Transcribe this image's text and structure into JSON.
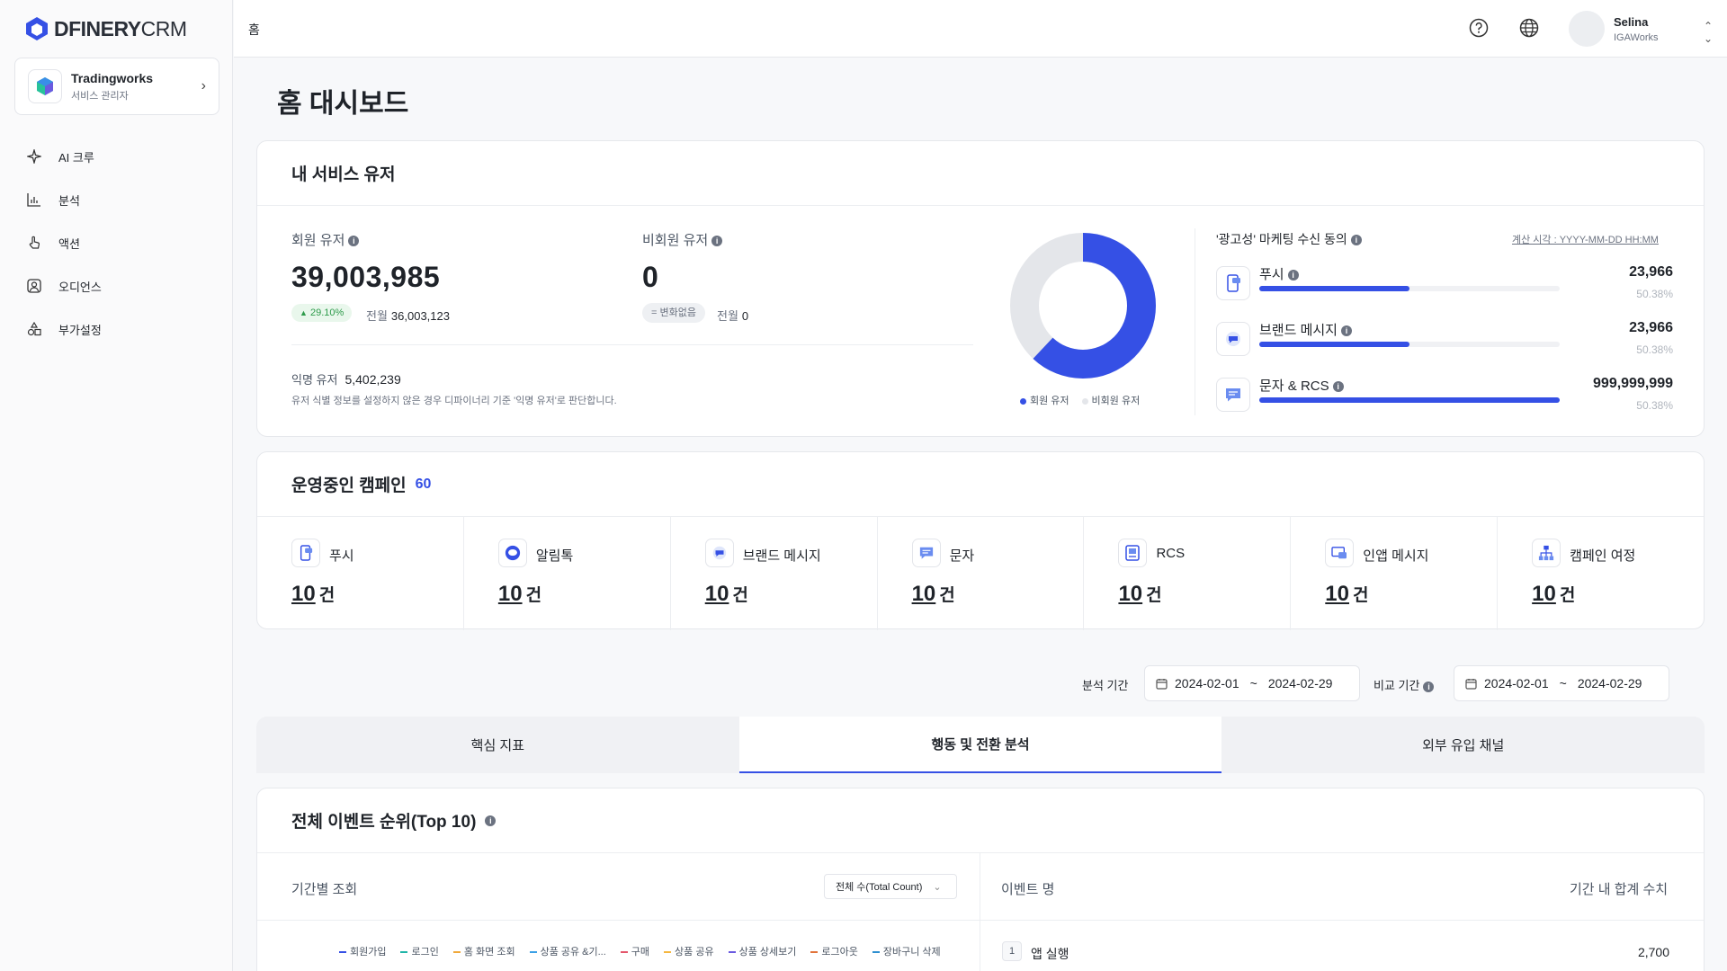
{
  "brand": {
    "name_bold": "DFINERY",
    "name_thin": "CRM",
    "accent": "#3550e5"
  },
  "workspace": {
    "name": "Tradingworks",
    "role": "서비스 관리자"
  },
  "nav": [
    {
      "label": "AI 크루",
      "icon": "sparkle-icon"
    },
    {
      "label": "분석",
      "icon": "bar-chart-icon"
    },
    {
      "label": "액션",
      "icon": "hand-pointer-icon"
    },
    {
      "label": "오디언스",
      "icon": "user-square-icon"
    },
    {
      "label": "부가설정",
      "icon": "shapes-icon"
    }
  ],
  "topbar": {
    "breadcrumb": "홈",
    "user_name": "Selina",
    "user_org": "IGAWorks"
  },
  "page": {
    "title": "홈 대시보드"
  },
  "service_users": {
    "title": "내 서비스 유저",
    "member_label": "회원 유저",
    "member_value": "39,003,985",
    "member_change": "29.10%",
    "member_prev_label": "전월",
    "member_prev_value": "36,003,123",
    "nonmember_label": "비회원 유저",
    "nonmember_value": "0",
    "nonmember_change": "변화없음",
    "nonmember_prev_label": "전월",
    "nonmember_prev_value": "0",
    "anon_label": "익명 유저",
    "anon_value": "5,402,239",
    "anon_desc": "유저 식별 정보를 설정하지 않은 경우 디파이너리 기준 '익명 유저'로 판단합니다.",
    "legend_member": "회원 유저",
    "legend_nonmember": "비회원 유저",
    "donut_member_fraction": 0.62,
    "color_member": "#3550e5",
    "color_nonmember": "#e4e6ea"
  },
  "marketing": {
    "title": "'광고성' 마케팅 수신 동의",
    "calc_time": "계산 시각 : YYYY-MM-DD HH:MM",
    "rows": [
      {
        "name": "푸시",
        "value": "23,966",
        "pct": "50.38%",
        "fill": 0.5
      },
      {
        "name": "브랜드 메시지",
        "value": "23,966",
        "pct": "50.38%",
        "fill": 0.5
      },
      {
        "name": "문자 & RCS",
        "value": "999,999,999",
        "pct": "50.38%",
        "fill": 1.0
      }
    ]
  },
  "campaigns": {
    "title": "운영중인 캠페인",
    "count": "60",
    "unit": "건",
    "items": [
      {
        "name": "푸시",
        "value": "10"
      },
      {
        "name": "알림톡",
        "value": "10"
      },
      {
        "name": "브랜드 메시지",
        "value": "10"
      },
      {
        "name": "문자",
        "value": "10"
      },
      {
        "name": "RCS",
        "value": "10"
      },
      {
        "name": "인앱 메시지",
        "value": "10"
      },
      {
        "name": "캠페인 여정",
        "value": "10"
      }
    ]
  },
  "period": {
    "analysis_label": "분석 기간",
    "analysis_start": "2024-02-01",
    "analysis_end": "2024-02-29",
    "compare_label": "비교 기간",
    "compare_start": "2024-02-01",
    "compare_end": "2024-02-29",
    "separator": "~"
  },
  "tabs": [
    {
      "label": "핵심 지표",
      "active": false
    },
    {
      "label": "행동 및 전환 분석",
      "active": true
    },
    {
      "label": "외부 유입 채널",
      "active": false
    }
  ],
  "events": {
    "title": "전체 이벤트 순위(Top 10)",
    "period_view_label": "기간별 조회",
    "select_value": "전체 수(Total Count)",
    "col_event_name": "이벤트 명",
    "col_total": "기간 내 합계 수치",
    "legend": [
      {
        "label": "회원가입",
        "color": "#3550e5"
      },
      {
        "label": "로그인",
        "color": "#1fb5a8"
      },
      {
        "label": "홈 화면 조회",
        "color": "#f0a93b"
      },
      {
        "label": "상품 공유 &기...",
        "color": "#3aa0e6"
      },
      {
        "label": "구매",
        "color": "#e4566b"
      },
      {
        "label": "상품 공유",
        "color": "#f5b740"
      },
      {
        "label": "상품 상세보기",
        "color": "#6a5ae0"
      },
      {
        "label": "로그아웃",
        "color": "#e2733a"
      },
      {
        "label": "장바구니 삭제",
        "color": "#2d8fd0"
      }
    ],
    "rows": [
      {
        "rank": "1",
        "name": "앱 실행",
        "value": "2,700"
      }
    ]
  }
}
